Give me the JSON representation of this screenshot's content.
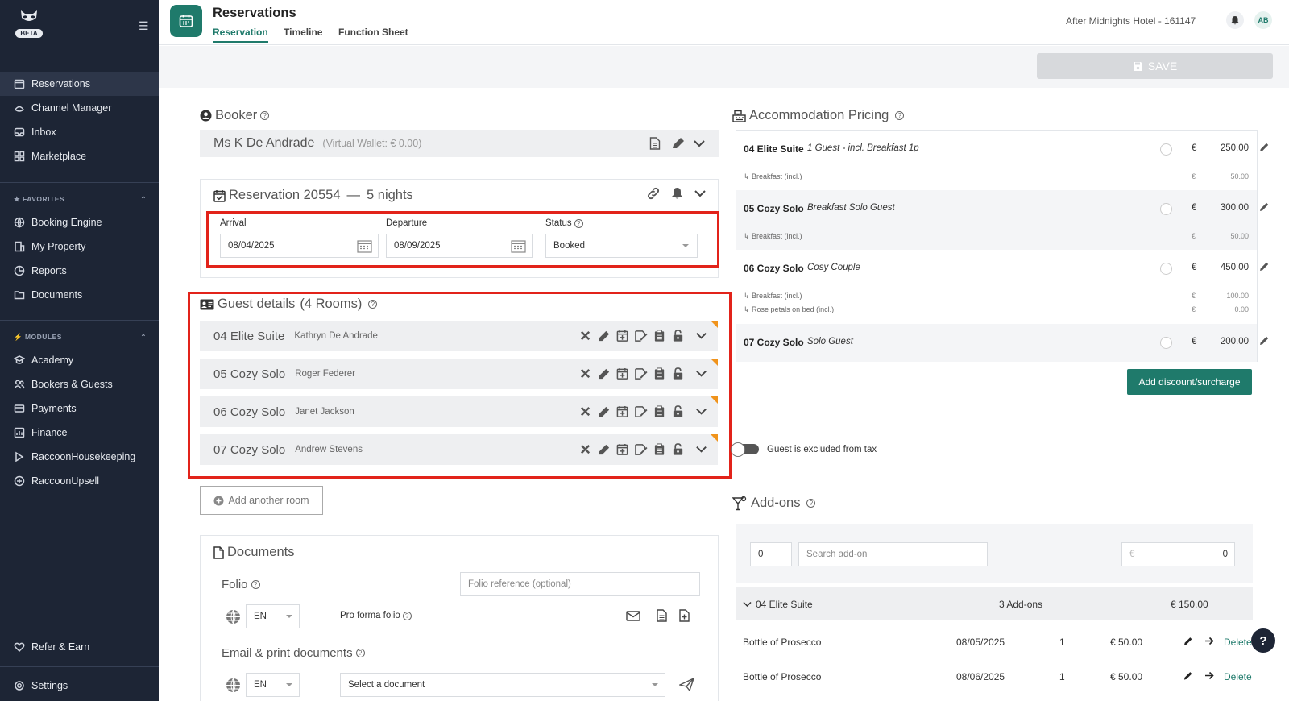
{
  "sidebar": {
    "beta": "BETA",
    "items": [
      {
        "label": "Reservations",
        "icon": "calendar-icon"
      },
      {
        "label": "Channel Manager",
        "icon": "channel-icon"
      },
      {
        "label": "Inbox",
        "icon": "inbox-icon"
      },
      {
        "label": "Marketplace",
        "icon": "grid-icon"
      }
    ],
    "favorites_title": "FAVORITES",
    "favorites": [
      {
        "label": "Booking Engine",
        "icon": "globe-icon"
      },
      {
        "label": "My Property",
        "icon": "building-icon"
      },
      {
        "label": "Reports",
        "icon": "chart-icon"
      },
      {
        "label": "Documents",
        "icon": "folder-icon"
      }
    ],
    "modules_title": "MODULES",
    "modules": [
      {
        "label": "Academy",
        "icon": "academy-icon"
      },
      {
        "label": "Bookers & Guests",
        "icon": "users-icon"
      },
      {
        "label": "Payments",
        "icon": "card-icon"
      },
      {
        "label": "Finance",
        "icon": "finance-icon"
      },
      {
        "label": "RaccoonHousekeeping",
        "icon": "broom-icon"
      },
      {
        "label": "RaccoonUpsell",
        "icon": "plus-circle-icon"
      }
    ],
    "bottom": [
      {
        "label": "Refer & Earn",
        "icon": "heart-icon"
      },
      {
        "label": "Settings",
        "icon": "gear-icon"
      }
    ]
  },
  "header": {
    "title": "Reservations",
    "tabs": [
      "Reservation",
      "Timeline",
      "Function Sheet"
    ],
    "hotel": "After Midnights Hotel - 161147",
    "avatar": "AB",
    "save_label": "SAVE"
  },
  "booker": {
    "title": "Booker",
    "name": "Ms K De Andrade",
    "wallet": "(Virtual Wallet: € 0.00)"
  },
  "reservation": {
    "title": "Reservation 20554",
    "dash": "—",
    "nights": "5 nights",
    "arrival_label": "Arrival",
    "arrival": "08/04/2025",
    "departure_label": "Departure",
    "departure": "08/09/2025",
    "status_label": "Status",
    "status": "Booked"
  },
  "guests": {
    "title": "Guest details",
    "count": "(4 Rooms)",
    "rooms": [
      {
        "room": "04 Elite Suite",
        "guest": "Kathryn De Andrade"
      },
      {
        "room": "05 Cozy Solo",
        "guest": "Roger Federer"
      },
      {
        "room": "06 Cozy Solo",
        "guest": "Janet Jackson"
      },
      {
        "room": "07 Cozy Solo",
        "guest": "Andrew Stevens"
      }
    ],
    "add_room": "Add another room"
  },
  "documents": {
    "title": "Documents",
    "folio_label": "Folio",
    "folio_placeholder": "Folio reference (optional)",
    "lang": "EN",
    "pro_forma": "Pro forma folio",
    "email_label": "Email & print documents",
    "lang2": "EN",
    "select_doc": "Select a document"
  },
  "pricing": {
    "title": "Accommodation Pricing",
    "currency": "€",
    "rows": [
      {
        "room": "04 Elite Suite",
        "rate": "1 Guest - incl. Breakfast 1p",
        "amount": "250.00",
        "subs": [
          {
            "label": "↳ Breakfast (incl.)",
            "amount": "50.00"
          }
        ]
      },
      {
        "room": "05 Cozy Solo",
        "rate": "Breakfast Solo Guest",
        "amount": "300.00",
        "subs": [
          {
            "label": "↳ Breakfast (incl.)",
            "amount": "50.00"
          }
        ]
      },
      {
        "room": "06 Cozy Solo",
        "rate": "Cosy Couple",
        "amount": "450.00",
        "subs": [
          {
            "label": "↳ Breakfast (incl.)",
            "amount": "100.00"
          },
          {
            "label": "↳ Rose petals on bed (incl.)",
            "amount": "0.00"
          }
        ]
      },
      {
        "room": "07 Cozy Solo",
        "rate": "Solo Guest",
        "amount": "200.00",
        "subs": []
      }
    ],
    "add_discount": "Add discount/surcharge",
    "tax_toggle": "Guest is excluded from tax"
  },
  "addons": {
    "title": "Add-ons",
    "qty": "0",
    "search_placeholder": "Search add-on",
    "price_prefix": "€",
    "price": "0",
    "group": {
      "room": "04 Elite Suite",
      "count": "3 Add-ons",
      "total": "€ 150.00"
    },
    "items": [
      {
        "name": "Bottle of Prosecco",
        "date": "08/05/2025",
        "qty": "1",
        "price": "€ 50.00",
        "action": "Delete"
      },
      {
        "name": "Bottle of Prosecco",
        "date": "08/06/2025",
        "qty": "1",
        "price": "€ 50.00",
        "action": "Delete"
      }
    ]
  },
  "help": "?"
}
